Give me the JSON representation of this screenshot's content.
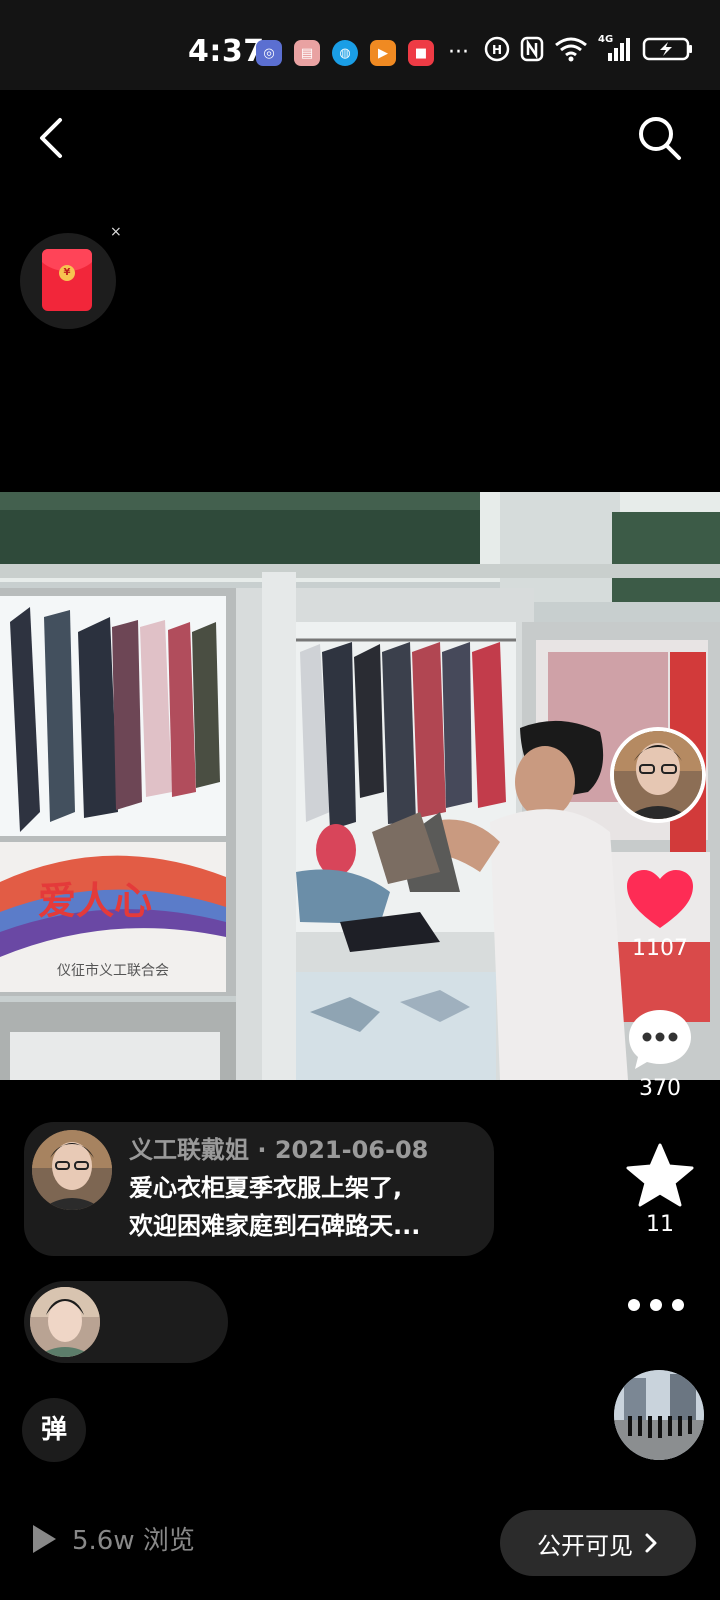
{
  "status_bar": {
    "time": "4:37",
    "notification_icons": [
      "app-icon-blue",
      "gift-box-icon",
      "browser-icon",
      "video-play-icon",
      "red-app-icon"
    ],
    "overflow": "···",
    "network": "4G",
    "system_icons": [
      "hd-call-icon",
      "nfc-icon",
      "wifi-icon",
      "signal-icon",
      "battery-charging-icon"
    ]
  },
  "nav": {
    "back_icon": "chevron-left-icon",
    "search_icon": "search-icon"
  },
  "red_packet": {
    "icon": "red-envelope-icon",
    "coin_symbol": "¥",
    "close_symbol": "×"
  },
  "video": {
    "banner_text": "爱人心",
    "banner_org": "仪征市义工联合会"
  },
  "actions": {
    "likes": "1107",
    "comments": "370",
    "favorites": "11"
  },
  "caption": {
    "meta": "义工联戴姐 · 2021-06-08",
    "line1": "爱心衣柜夏季衣服上架了,",
    "line2": "欢迎困难家庭到石碑路天..."
  },
  "danmu_label": "弹",
  "footer": {
    "views": "5.6w 浏览",
    "visibility": "公开可见"
  },
  "colors": {
    "like": "#fe2c55",
    "background": "#000000",
    "card": "#1c1c1c"
  }
}
